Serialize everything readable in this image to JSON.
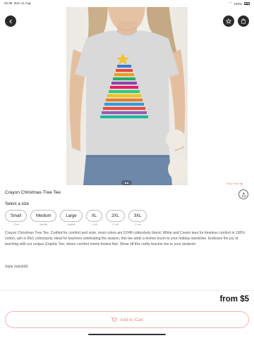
{
  "status_bar": {
    "time": "02:38",
    "date": "Mon 11 Aug",
    "battery": "100%"
  },
  "hero": {
    "play_link": "Play Video"
  },
  "product": {
    "title": "Crayon Christmas Tree Tee",
    "select_size_label": "Select a size",
    "sizes": [
      {
        "label": "Small",
        "stock": "1 Left"
      },
      {
        "label": "Medium",
        "stock": "Waitlist"
      },
      {
        "label": "Large",
        "stock": "Waitlist"
      },
      {
        "label": "XL",
        "stock": "1 Left"
      },
      {
        "label": "2XL",
        "stock": "2 Left"
      },
      {
        "label": "3XL",
        "stock": "2 Left"
      }
    ],
    "description": "Crayon Christmas Tree Tee. Crafted for comfort and style, most colors are 52/48 cotton/poly blend, White and Cream tees for timeless comfort in 100% cotton, ash is 99/1 cotton/poly. Ideal for teachers celebrating the season, this tee adds a festive touch to your holiday wardrobe. Embrace the joy of teaching with our unique Graphic Tee, where comfort meets festive flair. Show off this crafty teacher tee to your students",
    "style": "Style #sku683",
    "price": "from $5",
    "add_to_cart": "Add to Cart"
  },
  "colors": {
    "accent": "#e88a7a",
    "accent_border": "#f0b7ac",
    "dark_button": "#2b2b2b"
  },
  "icons": [
    "back-icon",
    "star-icon",
    "bag-icon",
    "play-icon",
    "share-icon",
    "cart-icon"
  ]
}
